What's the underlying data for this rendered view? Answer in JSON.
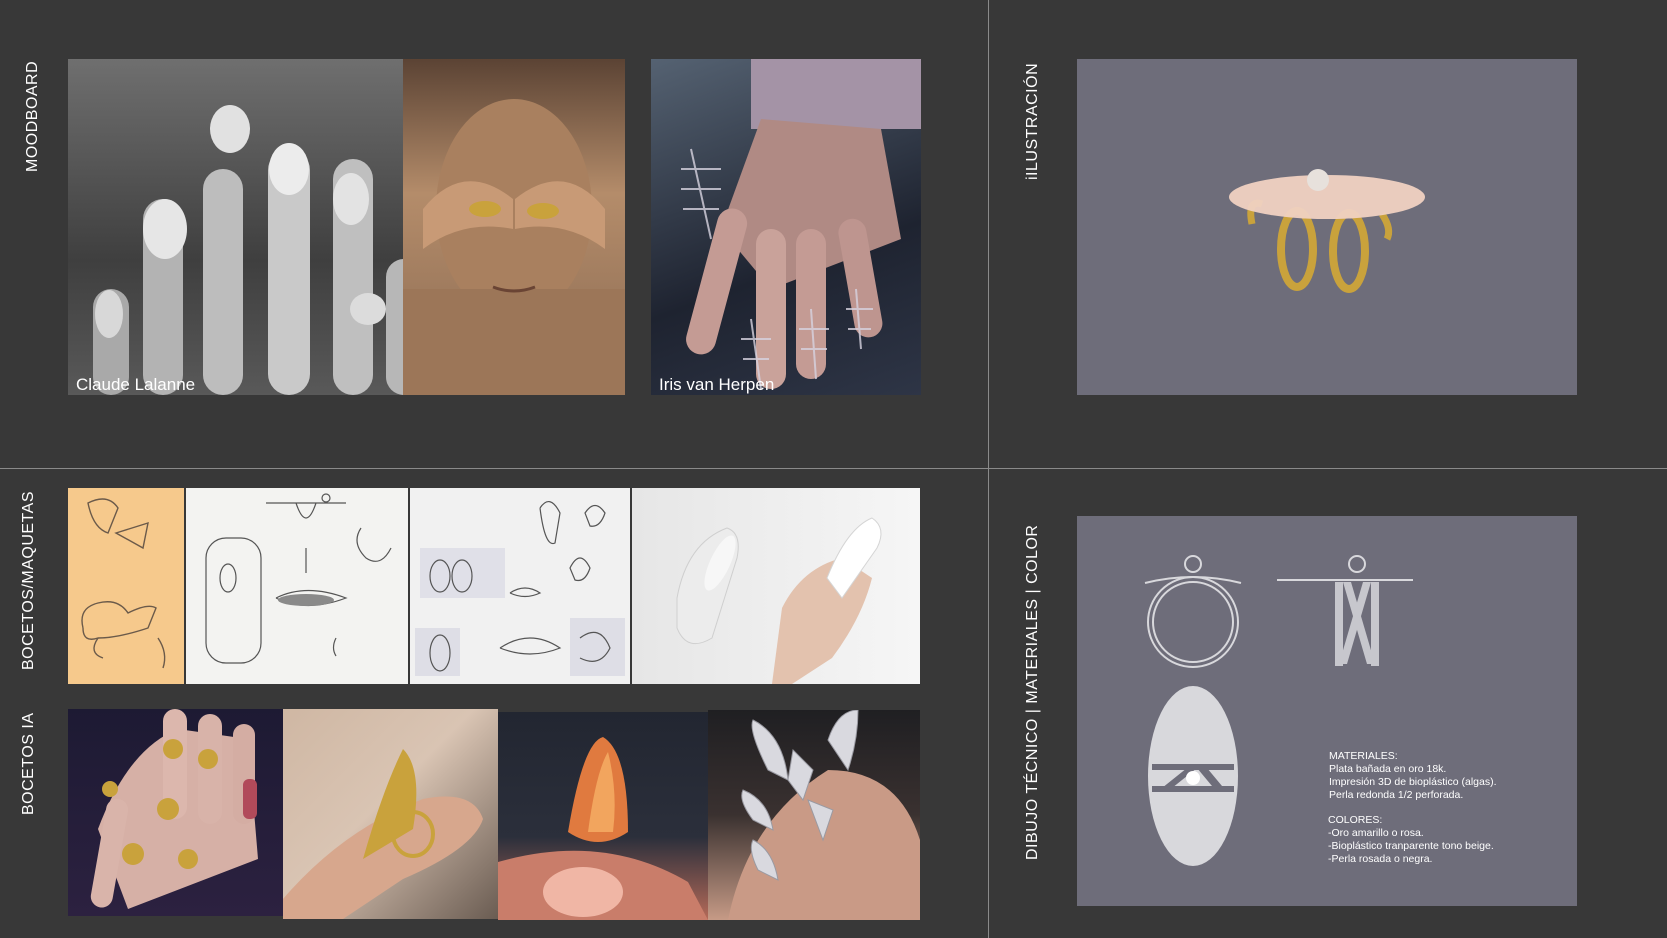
{
  "labels": {
    "moodboard": "MOODBOARD",
    "ilustracion": "iILUSTRACIÓN",
    "bocetos_maquetas": "BOCETOS/MAQUETAS",
    "bocetos_ia": "BOCETOS IA",
    "dibujo_tecnico": "DIBUJO TÉCNICO | MATERIALES | COLOR"
  },
  "captions": {
    "lalanne": "Claude Lalanne",
    "herpen": "Iris van Herpen"
  },
  "materiales": {
    "title": "MATERIALES:",
    "items": [
      "Plata bañada en oro 18k.",
      "Impresión 3D de bioplástico (algas).",
      "Perla redonda 1/2 perforada."
    ]
  },
  "colores": {
    "title": "COLORES:",
    "items": [
      "-Oro amarillo o rosa.",
      "-Bioplástico tranparente tono beige.",
      "-Perla rosada o negra."
    ]
  },
  "colors": {
    "background": "#383838",
    "panel": "#6e6d7a",
    "gold": "#c9a23c",
    "drawing": "#d8d8dc"
  }
}
